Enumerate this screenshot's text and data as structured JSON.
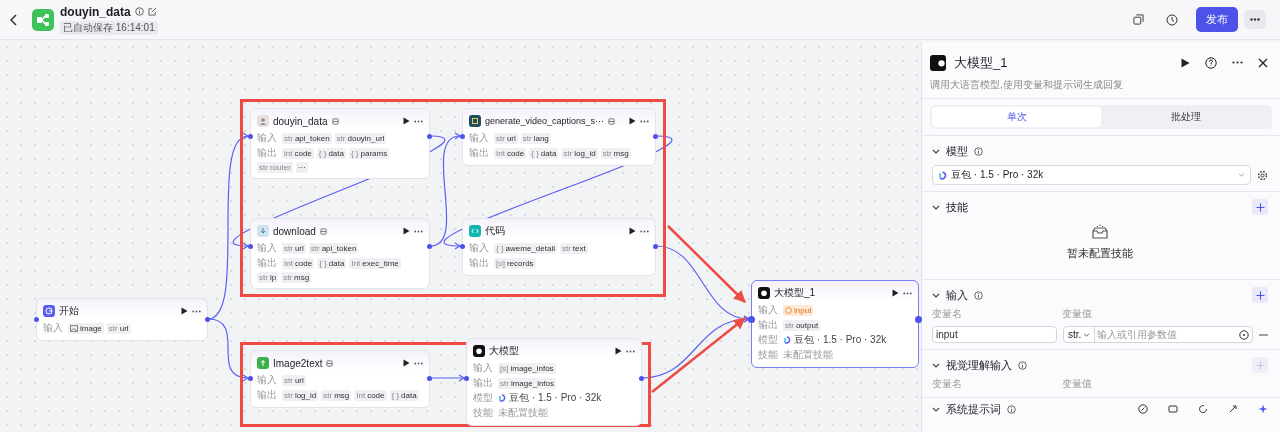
{
  "header": {
    "title": "douyin_data",
    "autosave": "已自动保存 16:14:01",
    "publish": "发布"
  },
  "nodes": [
    {
      "title": "douyin_data",
      "plugin": true,
      "selected": false,
      "rows": [
        {
          "label": "输入",
          "kind": "params",
          "params": [
            {
              "type": "str",
              "name": "api_token"
            },
            {
              "type": "str",
              "name": "douyin_url"
            }
          ]
        },
        {
          "label": "输出",
          "kind": "params",
          "params": [
            {
              "type": "int",
              "name": "code"
            },
            {
              "type": "{ }",
              "name": "data"
            },
            {
              "type": "{ }",
              "name": "params"
            },
            {
              "type": "str",
              "name": "router",
              "faded": true
            },
            {
              "kind": "more",
              "name": "···"
            }
          ]
        }
      ]
    },
    {
      "title": "generate_video_captions_s···",
      "plugin": true,
      "selected": false,
      "rows": [
        {
          "label": "输入",
          "kind": "params",
          "params": [
            {
              "type": "str",
              "name": "url"
            },
            {
              "type": "str",
              "name": "lang"
            }
          ]
        },
        {
          "label": "输出",
          "kind": "params",
          "params": [
            {
              "type": "Int",
              "name": "code"
            },
            {
              "type": "{ }",
              "name": "data"
            },
            {
              "type": "str",
              "name": "log_id"
            },
            {
              "type": "str",
              "name": "msg"
            }
          ]
        }
      ]
    },
    {
      "title": "download",
      "plugin": true,
      "selected": false,
      "rows": [
        {
          "label": "输入",
          "kind": "params",
          "params": [
            {
              "type": "str",
              "name": "url"
            },
            {
              "type": "str",
              "name": "api_token"
            }
          ]
        },
        {
          "label": "输出",
          "kind": "params",
          "params": [
            {
              "type": "Int",
              "name": "code"
            },
            {
              "type": "{ }",
              "name": "data"
            },
            {
              "type": "Int",
              "name": "exec_time"
            },
            {
              "type": "str",
              "name": "ip"
            },
            {
              "type": "str",
              "name": "msg"
            }
          ]
        }
      ]
    },
    {
      "title": "代码",
      "plugin": false,
      "selected": false,
      "rows": [
        {
          "label": "输入",
          "kind": "params",
          "params": [
            {
              "type": "{ }",
              "name": "aweme_detail"
            },
            {
              "type": "str",
              "name": "text"
            }
          ]
        },
        {
          "label": "输出",
          "kind": "params",
          "params": [
            {
              "type": "[o]",
              "name": "records"
            }
          ]
        }
      ]
    },
    {
      "title": "开始",
      "plugin": false,
      "selected": false,
      "rows": [
        {
          "label": "输入",
          "kind": "params",
          "params": [
            {
              "kind": "image",
              "name": "image"
            },
            {
              "type": "str",
              "name": "url"
            }
          ]
        }
      ]
    },
    {
      "title": "Image2text",
      "plugin": true,
      "selected": false,
      "rows": [
        {
          "label": "输入",
          "kind": "params",
          "params": [
            {
              "type": "str",
              "name": "url"
            }
          ]
        },
        {
          "label": "输出",
          "kind": "params",
          "params": [
            {
              "type": "str",
              "name": "log_id"
            },
            {
              "type": "str",
              "name": "msg"
            },
            {
              "type": "Int",
              "name": "code"
            },
            {
              "type": "{ }",
              "name": "data"
            }
          ]
        }
      ]
    },
    {
      "title": "大模型",
      "plugin": false,
      "selected": false,
      "rows": [
        {
          "label": "输入",
          "kind": "params",
          "params": [
            {
              "type": "[s]",
              "name": "image_infos"
            }
          ]
        },
        {
          "label": "输出",
          "kind": "params",
          "params": [
            {
              "type": "str",
              "name": "image_infos"
            }
          ]
        },
        {
          "label": "模型",
          "kind": "model",
          "text": "豆包 · 1.5 · Pro · 32k"
        },
        {
          "label": "技能",
          "kind": "text",
          "text": "未配置技能"
        }
      ]
    },
    {
      "title": "大模型_1",
      "plugin": false,
      "selected": true,
      "rows": [
        {
          "label": "输入",
          "kind": "params",
          "params": [
            {
              "kind": "warning",
              "name": "input"
            }
          ]
        },
        {
          "label": "输出",
          "kind": "params",
          "params": [
            {
              "type": "str",
              "name": "output"
            }
          ]
        },
        {
          "label": "模型",
          "kind": "model",
          "text": "豆包 · 1.5 · Pro · 32k"
        },
        {
          "label": "技能",
          "kind": "text",
          "text": "未配置技能"
        }
      ]
    }
  ],
  "panel": {
    "title": "大模型_1",
    "description": "调用大语言模型,使用变量和提示词生成回复",
    "tabs": [
      {
        "label": "单次",
        "selected": true
      },
      {
        "label": "批处理",
        "selected": false
      }
    ],
    "sections": [
      {
        "kind": "model",
        "title": "模型",
        "info": true,
        "value": "豆包 · 1.5 · Pro · 32k"
      },
      {
        "kind": "skills",
        "title": "技能",
        "info": false,
        "add_disabled": false,
        "empty_text": "暂未配置技能"
      },
      {
        "kind": "inputs",
        "title": "输入",
        "info": true,
        "add_disabled": false,
        "columns": [
          "变量名",
          "变量值"
        ],
        "rows": [
          {
            "name": "input",
            "type": "str.",
            "placeholder": "输入或引用参数值"
          }
        ]
      },
      {
        "kind": "inputs",
        "title": "视觉理解输入",
        "info": true,
        "add_disabled": true,
        "columns": [
          "变量名",
          "变量值"
        ]
      },
      {
        "kind": "prompt",
        "title": "系统提示词",
        "info": true
      }
    ]
  }
}
